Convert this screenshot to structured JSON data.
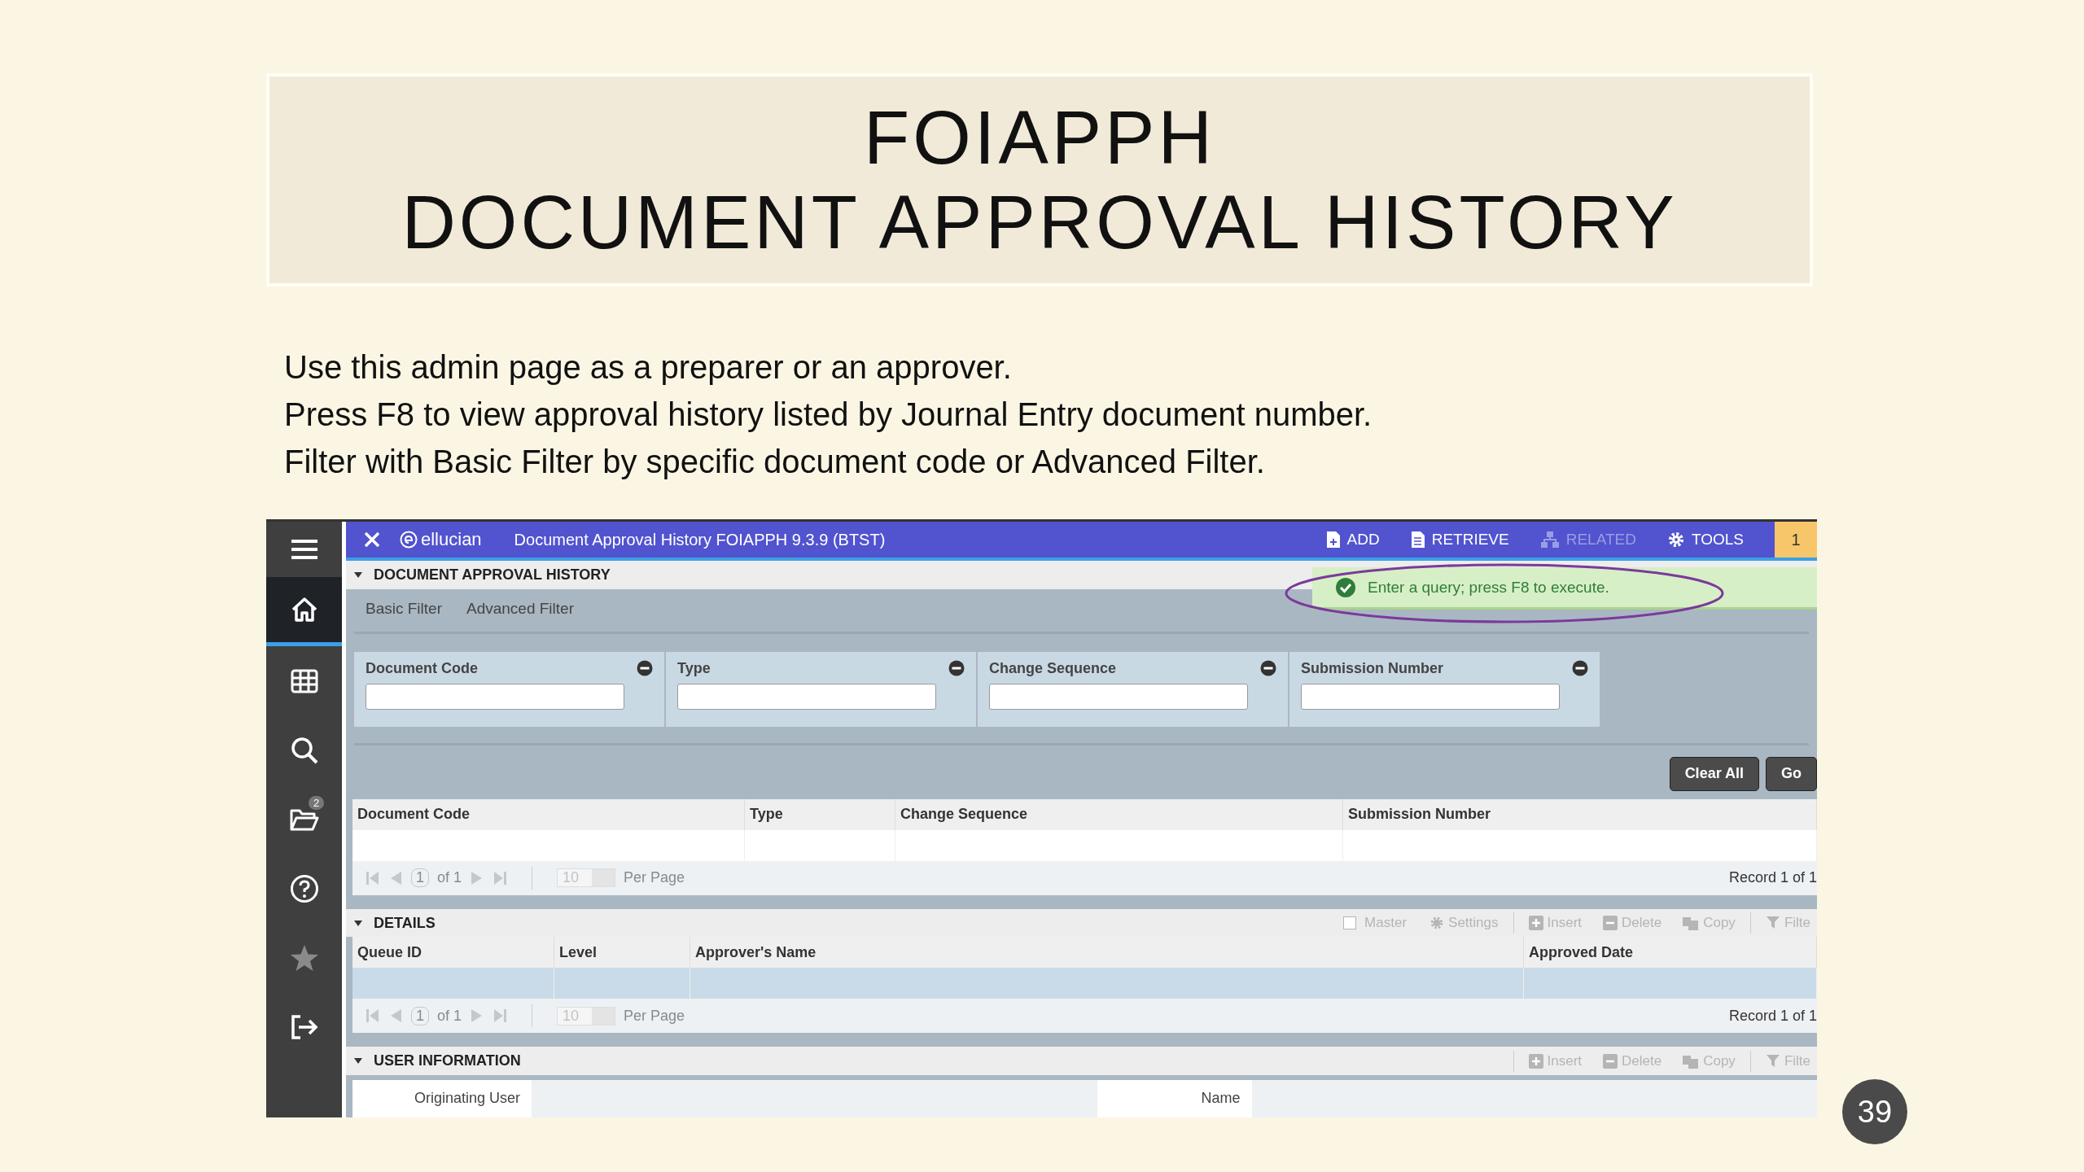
{
  "slide": {
    "title_lines": [
      "FOIAPPH",
      "DOCUMENT APPROVAL HISTORY"
    ],
    "body_lines": [
      "Use this admin page as a preparer or an approver.",
      "Press F8 to view approval history listed by Journal Entry document number.",
      "Filter with Basic Filter by specific document code or Advanced Filter."
    ],
    "page_number": "39"
  },
  "app": {
    "sidebar": {
      "items": [
        {
          "kind": "menu",
          "selected": false
        },
        {
          "kind": "home",
          "selected": true
        },
        {
          "kind": "grid",
          "selected": false
        },
        {
          "kind": "search",
          "selected": false
        },
        {
          "kind": "folder",
          "selected": false,
          "badge": "2"
        },
        {
          "kind": "help",
          "selected": false
        },
        {
          "kind": "star",
          "selected": false
        },
        {
          "kind": "signout",
          "selected": false
        }
      ]
    },
    "header": {
      "brand": "ellucian",
      "title": "Document Approval History FOIAPPH 9.3.9 (BTST)",
      "actions": [
        {
          "kind": "add",
          "label": "ADD",
          "disabled": false
        },
        {
          "kind": "retrieve",
          "label": "RETRIEVE",
          "disabled": false
        },
        {
          "kind": "related",
          "label": "RELATED",
          "disabled": true
        },
        {
          "kind": "tools",
          "label": "TOOLS",
          "disabled": false
        }
      ],
      "notification_count": "1"
    },
    "message": {
      "text": "Enter a query; press F8 to execute."
    },
    "main_section": {
      "title": "DOCUMENT APPROVAL HISTORY",
      "filter_tabs": [
        {
          "label": "Basic Filter",
          "selected": false
        },
        {
          "label": "Advanced Filter",
          "selected": false
        }
      ],
      "filter_fields": [
        {
          "label": "Document Code"
        },
        {
          "label": "Type"
        },
        {
          "label": "Change Sequence"
        },
        {
          "label": "Submission Number"
        }
      ],
      "buttons": [
        "Clear All",
        "Go"
      ],
      "columns": [
        "Document Code",
        "Type",
        "Change Sequence",
        "Submission Number"
      ],
      "pager": {
        "page": "1",
        "of": "of 1",
        "per_page": "10",
        "per_page_label": "Per Page",
        "record": "Record 1 of 1"
      }
    },
    "details": {
      "title": "DETAILS",
      "toolbar": [
        {
          "kind": "checkbox",
          "label": "Master",
          "checked": false
        },
        {
          "kind": "settings",
          "label": "Settings"
        },
        {
          "kind": "insert",
          "label": "Insert"
        },
        {
          "kind": "delete",
          "label": "Delete"
        },
        {
          "kind": "copy",
          "label": "Copy"
        },
        {
          "kind": "filter",
          "label": "Filte"
        }
      ],
      "columns": [
        "Queue ID",
        "Level",
        "Approver's Name",
        "Approved Date"
      ],
      "pager": {
        "page": "1",
        "of": "of 1",
        "per_page": "10",
        "per_page_label": "Per Page",
        "record": "Record 1 of 1"
      }
    },
    "user_information": {
      "title": "USER INFORMATION",
      "toolbar": [
        {
          "kind": "insert",
          "label": "Insert"
        },
        {
          "kind": "delete",
          "label": "Delete"
        },
        {
          "kind": "copy",
          "label": "Copy"
        },
        {
          "kind": "filter",
          "label": "Filte"
        }
      ],
      "fields": [
        {
          "label": "Originating User"
        },
        {
          "label": "Name"
        }
      ]
    }
  }
}
